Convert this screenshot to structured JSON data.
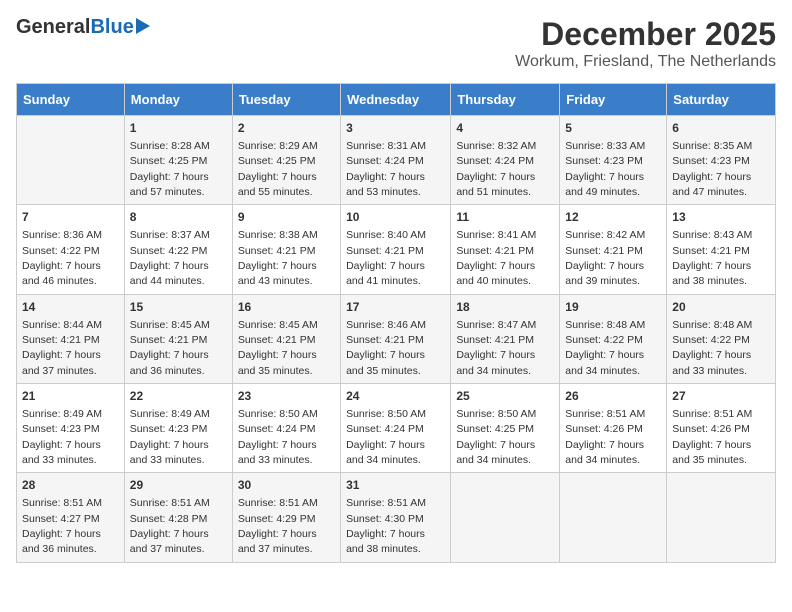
{
  "header": {
    "logo_general": "General",
    "logo_blue": "Blue",
    "title": "December 2025",
    "subtitle": "Workum, Friesland, The Netherlands"
  },
  "days_of_week": [
    "Sunday",
    "Monday",
    "Tuesday",
    "Wednesday",
    "Thursday",
    "Friday",
    "Saturday"
  ],
  "weeks": [
    [
      {
        "day": "",
        "info": ""
      },
      {
        "day": "1",
        "info": "Sunrise: 8:28 AM\nSunset: 4:25 PM\nDaylight: 7 hours\nand 57 minutes."
      },
      {
        "day": "2",
        "info": "Sunrise: 8:29 AM\nSunset: 4:25 PM\nDaylight: 7 hours\nand 55 minutes."
      },
      {
        "day": "3",
        "info": "Sunrise: 8:31 AM\nSunset: 4:24 PM\nDaylight: 7 hours\nand 53 minutes."
      },
      {
        "day": "4",
        "info": "Sunrise: 8:32 AM\nSunset: 4:24 PM\nDaylight: 7 hours\nand 51 minutes."
      },
      {
        "day": "5",
        "info": "Sunrise: 8:33 AM\nSunset: 4:23 PM\nDaylight: 7 hours\nand 49 minutes."
      },
      {
        "day": "6",
        "info": "Sunrise: 8:35 AM\nSunset: 4:23 PM\nDaylight: 7 hours\nand 47 minutes."
      }
    ],
    [
      {
        "day": "7",
        "info": "Sunrise: 8:36 AM\nSunset: 4:22 PM\nDaylight: 7 hours\nand 46 minutes."
      },
      {
        "day": "8",
        "info": "Sunrise: 8:37 AM\nSunset: 4:22 PM\nDaylight: 7 hours\nand 44 minutes."
      },
      {
        "day": "9",
        "info": "Sunrise: 8:38 AM\nSunset: 4:21 PM\nDaylight: 7 hours\nand 43 minutes."
      },
      {
        "day": "10",
        "info": "Sunrise: 8:40 AM\nSunset: 4:21 PM\nDaylight: 7 hours\nand 41 minutes."
      },
      {
        "day": "11",
        "info": "Sunrise: 8:41 AM\nSunset: 4:21 PM\nDaylight: 7 hours\nand 40 minutes."
      },
      {
        "day": "12",
        "info": "Sunrise: 8:42 AM\nSunset: 4:21 PM\nDaylight: 7 hours\nand 39 minutes."
      },
      {
        "day": "13",
        "info": "Sunrise: 8:43 AM\nSunset: 4:21 PM\nDaylight: 7 hours\nand 38 minutes."
      }
    ],
    [
      {
        "day": "14",
        "info": "Sunrise: 8:44 AM\nSunset: 4:21 PM\nDaylight: 7 hours\nand 37 minutes."
      },
      {
        "day": "15",
        "info": "Sunrise: 8:45 AM\nSunset: 4:21 PM\nDaylight: 7 hours\nand 36 minutes."
      },
      {
        "day": "16",
        "info": "Sunrise: 8:45 AM\nSunset: 4:21 PM\nDaylight: 7 hours\nand 35 minutes."
      },
      {
        "day": "17",
        "info": "Sunrise: 8:46 AM\nSunset: 4:21 PM\nDaylight: 7 hours\nand 35 minutes."
      },
      {
        "day": "18",
        "info": "Sunrise: 8:47 AM\nSunset: 4:21 PM\nDaylight: 7 hours\nand 34 minutes."
      },
      {
        "day": "19",
        "info": "Sunrise: 8:48 AM\nSunset: 4:22 PM\nDaylight: 7 hours\nand 34 minutes."
      },
      {
        "day": "20",
        "info": "Sunrise: 8:48 AM\nSunset: 4:22 PM\nDaylight: 7 hours\nand 33 minutes."
      }
    ],
    [
      {
        "day": "21",
        "info": "Sunrise: 8:49 AM\nSunset: 4:23 PM\nDaylight: 7 hours\nand 33 minutes."
      },
      {
        "day": "22",
        "info": "Sunrise: 8:49 AM\nSunset: 4:23 PM\nDaylight: 7 hours\nand 33 minutes."
      },
      {
        "day": "23",
        "info": "Sunrise: 8:50 AM\nSunset: 4:24 PM\nDaylight: 7 hours\nand 33 minutes."
      },
      {
        "day": "24",
        "info": "Sunrise: 8:50 AM\nSunset: 4:24 PM\nDaylight: 7 hours\nand 34 minutes."
      },
      {
        "day": "25",
        "info": "Sunrise: 8:50 AM\nSunset: 4:25 PM\nDaylight: 7 hours\nand 34 minutes."
      },
      {
        "day": "26",
        "info": "Sunrise: 8:51 AM\nSunset: 4:26 PM\nDaylight: 7 hours\nand 34 minutes."
      },
      {
        "day": "27",
        "info": "Sunrise: 8:51 AM\nSunset: 4:26 PM\nDaylight: 7 hours\nand 35 minutes."
      }
    ],
    [
      {
        "day": "28",
        "info": "Sunrise: 8:51 AM\nSunset: 4:27 PM\nDaylight: 7 hours\nand 36 minutes."
      },
      {
        "day": "29",
        "info": "Sunrise: 8:51 AM\nSunset: 4:28 PM\nDaylight: 7 hours\nand 37 minutes."
      },
      {
        "day": "30",
        "info": "Sunrise: 8:51 AM\nSunset: 4:29 PM\nDaylight: 7 hours\nand 37 minutes."
      },
      {
        "day": "31",
        "info": "Sunrise: 8:51 AM\nSunset: 4:30 PM\nDaylight: 7 hours\nand 38 minutes."
      },
      {
        "day": "",
        "info": ""
      },
      {
        "day": "",
        "info": ""
      },
      {
        "day": "",
        "info": ""
      }
    ]
  ]
}
